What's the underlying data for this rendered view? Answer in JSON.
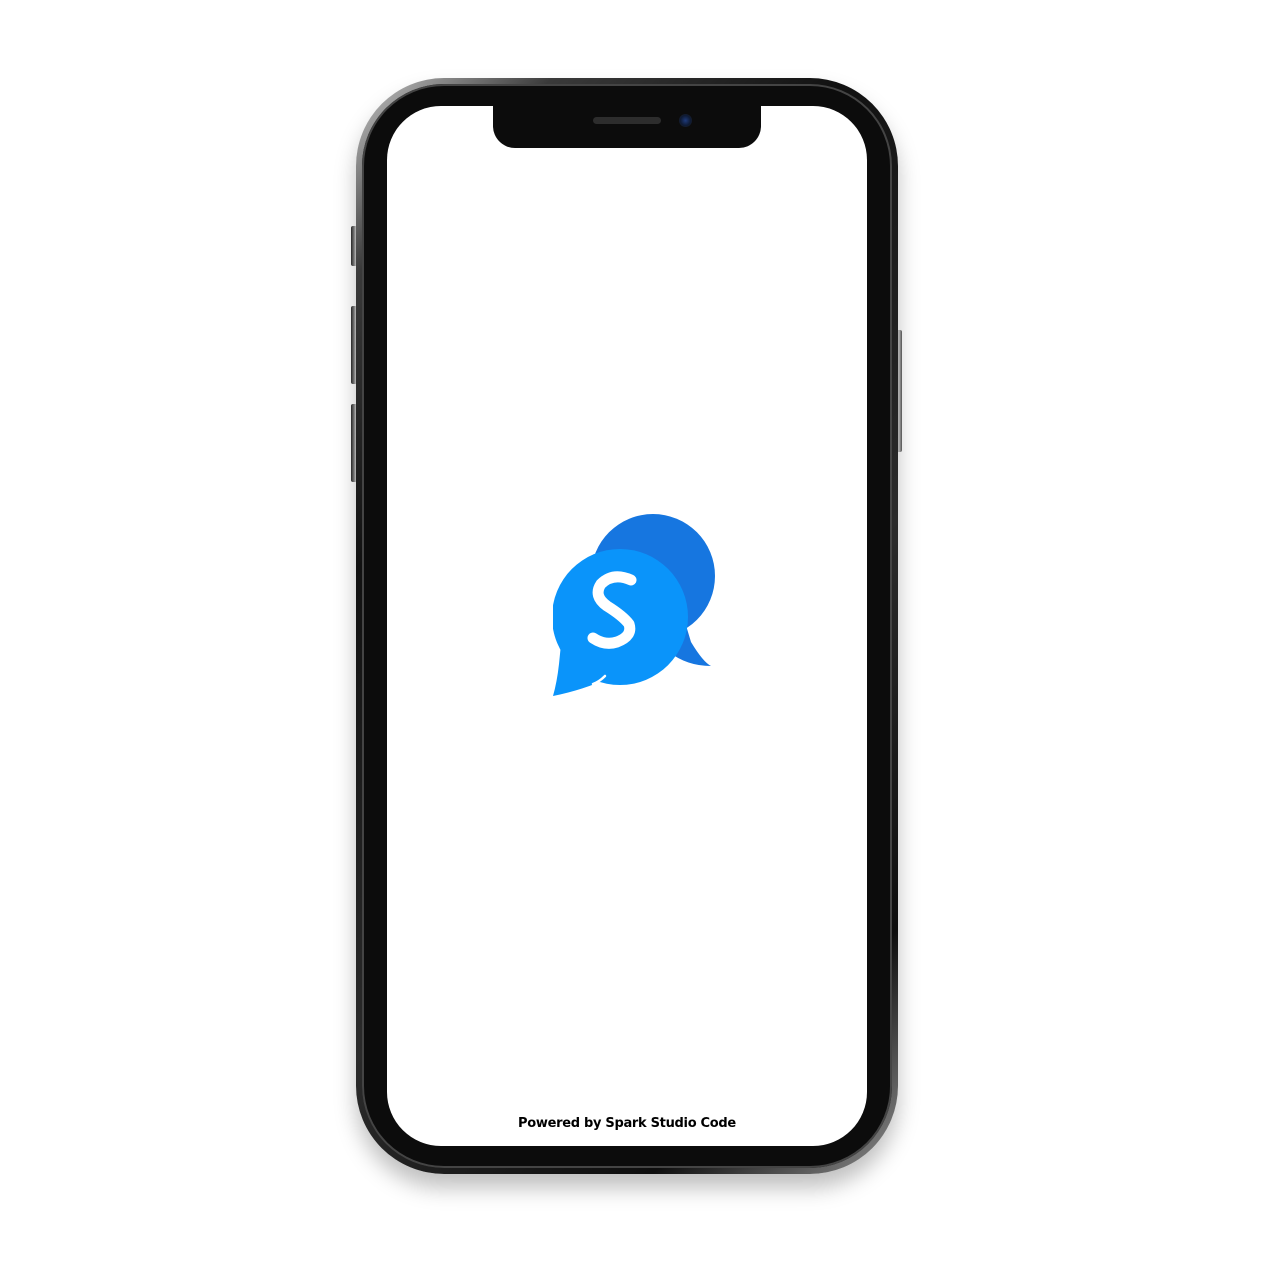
{
  "app": {
    "name": "Spark Studio Code splash",
    "logo_icon": "chat-bubbles-s-logo",
    "logo_letter": "S",
    "footer_text": "Powered by Spark Studio Code"
  },
  "colors": {
    "background": "#ffffff",
    "bubble_front": "#0a94fa",
    "bubble_back": "#1676e0",
    "footer_text": "#000000",
    "device_frame": "#111111"
  }
}
